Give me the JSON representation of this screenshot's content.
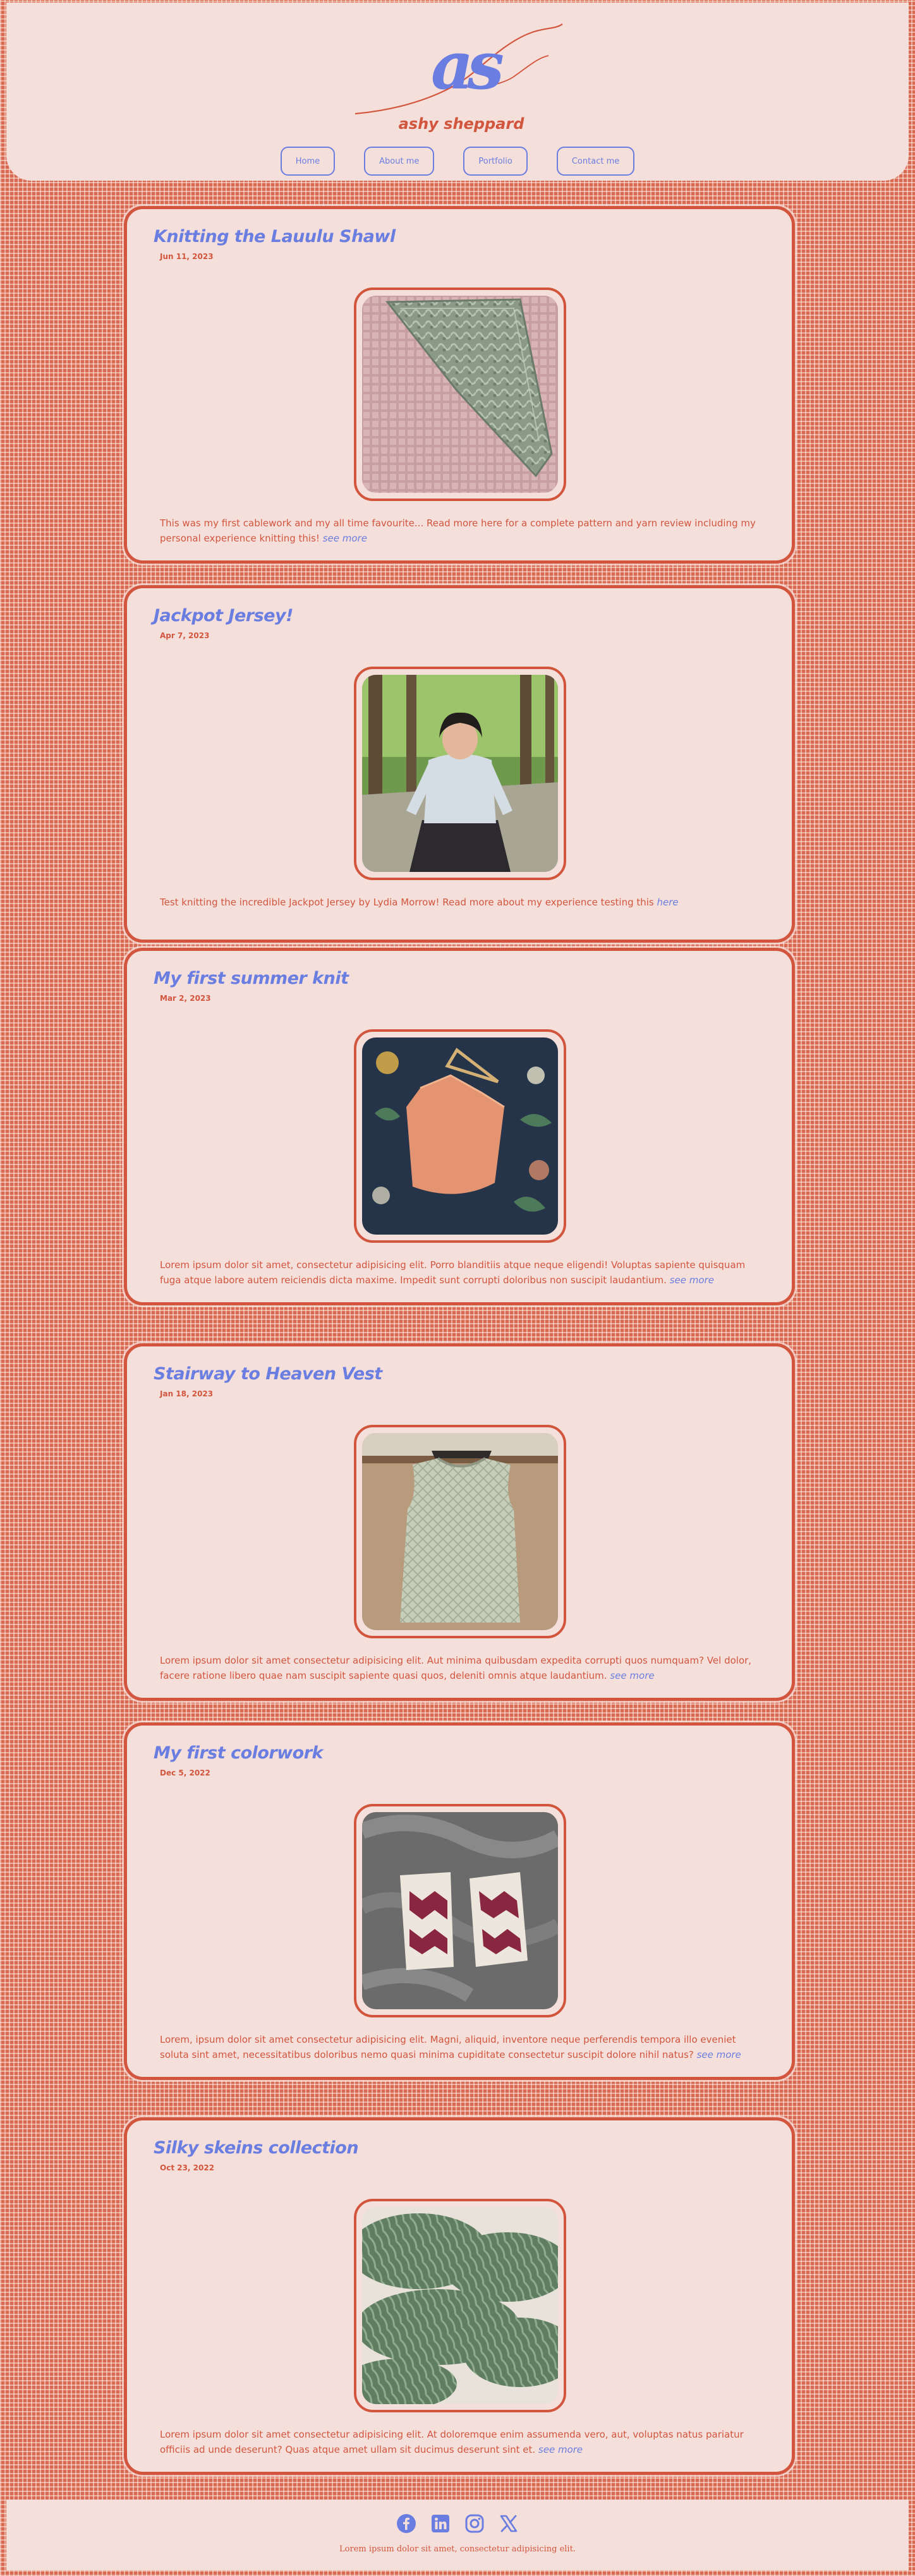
{
  "brand": {
    "monogram": "as",
    "name": "ashy sheppard"
  },
  "nav": [
    "Home",
    "About me",
    "Portfolio",
    "Contact me"
  ],
  "posts": [
    {
      "title": "Knitting the Lauulu Shawl",
      "date": "Jun 11, 2023",
      "image": "knitted-lace-shawl-photo",
      "text": "This was my first cablework and my all time favourite... Read more here for a complete pattern and yarn review including my personal experience knitting this!",
      "link": "see more"
    },
    {
      "title": "Jackpot Jersey!",
      "date": "Apr 7, 2023",
      "image": "person-wearing-jersey-photo",
      "text": "Test knitting the incredible Jackpot Jersey by Lydia Morrow! Read more about my experience testing this",
      "link": "here"
    },
    {
      "title": "My first summer knit",
      "date": "Mar 2, 2023",
      "image": "summer-top-on-hanger-photo",
      "text": "Lorem ipsum dolor sit amet, consectetur adipisicing elit. Porro blanditiis atque neque eligendi! Voluptas sapiente quisquam fuga atque labore autem reiciendis dicta maxime. Impedit sunt corrupti doloribus non suscipit laudantium.",
      "link": "see more"
    },
    {
      "title": "Stairway to Heaven Vest",
      "date": "Jan 18, 2023",
      "image": "knitted-vest-photo",
      "text": "Lorem ipsum dolor sit amet consectetur adipisicing elit. Aut minima quibusdam expedita corrupti quos numquam? Vel dolor, facere ratione libero quae nam suscipit sapiente quasi quos, deleniti omnis atque laudantium.",
      "link": "see more"
    },
    {
      "title": "My first colorwork",
      "date": "Dec 5, 2022",
      "image": "colorwork-mittens-photo",
      "text": "Lorem, ipsum dolor sit amet consectetur adipisicing elit. Magni, aliquid, inventore neque perferendis tempora illo eveniet soluta sint amet, necessitatibus doloribus nemo quasi minima cupiditate consectetur suscipit dolore nihil natus?",
      "link": "see more"
    },
    {
      "title": "Silky skeins collection",
      "date": "Oct 23, 2022",
      "image": "yarn-skeins-photo",
      "text": "Lorem ipsum dolor sit amet consectetur adipisicing elit. At doloremque enim assumenda vero, aut, voluptas natus pariatur officiis ad unde deserunt? Quas atque amet ullam sit ducimus deserunt sint et.",
      "link": "see more"
    }
  ],
  "social_icons": [
    "facebook-icon",
    "linkedin-icon",
    "instagram-icon",
    "x-icon"
  ],
  "footer": {
    "text": "Lorem ipsum dolor sit amet, consectetur adipisicing elit."
  },
  "colors": {
    "accent_blue": "#6a7de0",
    "accent_red": "#d2553e",
    "panel_pink": "#f5dfdb",
    "background": "#d86a54"
  }
}
